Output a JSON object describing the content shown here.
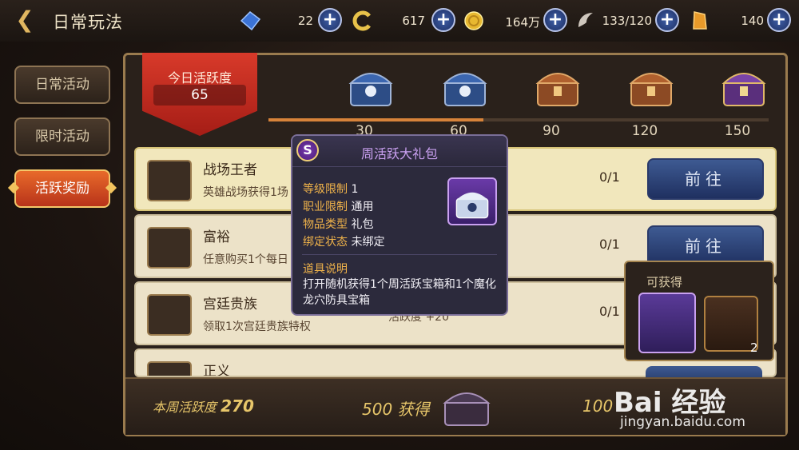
{
  "header": {
    "back_icon": "back-arrow-icon",
    "title": "日常玩法",
    "resources": [
      {
        "icon": "blue-crystal-icon",
        "value": "22"
      },
      {
        "icon": "energy-swirl-icon",
        "value": "617"
      },
      {
        "icon": "gold-coin-icon",
        "value": "164万"
      },
      {
        "icon": "wing-stamina-icon",
        "value": "133/120"
      },
      {
        "icon": "amber-crystal-icon",
        "value": "140"
      }
    ]
  },
  "sidebar": {
    "items": [
      {
        "label": "日常活动",
        "active": false
      },
      {
        "label": "限时活动",
        "active": false
      },
      {
        "label": "活跃奖励",
        "active": true
      }
    ]
  },
  "activity": {
    "today_label": "今日活跃度",
    "today_value": "65",
    "progress": 0.43,
    "milestones": [
      {
        "value": "30",
        "chest": "blue"
      },
      {
        "value": "60",
        "chest": "blue"
      },
      {
        "value": "90",
        "chest": "bronze"
      },
      {
        "value": "120",
        "chest": "bronze"
      },
      {
        "value": "150",
        "chest": "purple"
      }
    ]
  },
  "tasks": [
    {
      "name": "战场王者",
      "desc": "英雄战场获得1场",
      "progress": "0/1",
      "button": "前往",
      "highlight": true
    },
    {
      "name": "富裕",
      "desc": "任意购买1个每日",
      "progress": "0/1",
      "button": "前往",
      "highlight": false
    },
    {
      "name": "宫廷贵族",
      "desc": "领取1次宫廷贵族特权",
      "reward": "活跃度 +20",
      "progress": "0/1",
      "button": "",
      "highlight": false
    },
    {
      "name": "正义",
      "desc": "",
      "progress": "",
      "button": "",
      "highlight": false
    }
  ],
  "footer": {
    "week_label": "本周活跃度",
    "week_value": "270",
    "reward_500": "500 获得",
    "reward_1000": "100"
  },
  "tooltip": {
    "title": "周活跃大礼包",
    "badge": "S",
    "rows": [
      {
        "key": "等级限制",
        "value": "1"
      },
      {
        "key": "职业限制",
        "value": "通用"
      },
      {
        "key": "物品类型",
        "value": "礼包"
      },
      {
        "key": "绑定状态",
        "value": "未绑定"
      }
    ],
    "desc_title": "道具说明",
    "desc": "打开随机获得1个周活跃宝箱和1个魔化龙穴防具宝箱"
  },
  "obtain": {
    "title": "可获得",
    "count": "2"
  },
  "watermark": {
    "line1": "Bai 经验",
    "line2": "jingyan.baidu.com"
  },
  "colors": {
    "accent": "#d83a2a",
    "gold": "#e7c66a",
    "tooltip_title": "#c9a0f0"
  }
}
